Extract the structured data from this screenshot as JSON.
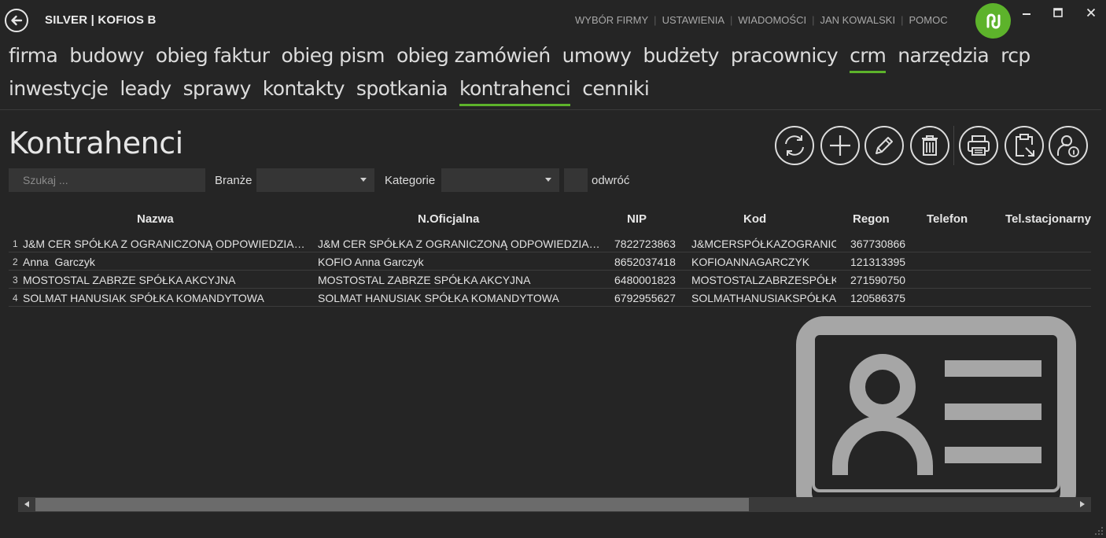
{
  "app": {
    "title": "SILVER | KOFIOS B"
  },
  "topnav": [
    {
      "label": "WYBÓR FIRMY"
    },
    {
      "label": "USTAWIENIA"
    },
    {
      "label": "WIADOMOŚCI"
    },
    {
      "label": "JAN KOWALSKI"
    },
    {
      "label": "POMOC"
    }
  ],
  "nav": {
    "row1": [
      {
        "label": "firma",
        "active": false
      },
      {
        "label": "budowy",
        "active": false
      },
      {
        "label": "obieg faktur",
        "active": false
      },
      {
        "label": "obieg pism",
        "active": false
      },
      {
        "label": "obieg zamówień",
        "active": false
      },
      {
        "label": "umowy",
        "active": false
      },
      {
        "label": "budżety",
        "active": false
      },
      {
        "label": "pracownicy",
        "active": false
      },
      {
        "label": "crm",
        "active": true
      },
      {
        "label": "narzędzia",
        "active": false
      },
      {
        "label": "rcp",
        "active": false
      }
    ],
    "row2": [
      {
        "label": "inwestycje",
        "active": false
      },
      {
        "label": "leady",
        "active": false
      },
      {
        "label": "sprawy",
        "active": false
      },
      {
        "label": "kontakty",
        "active": false
      },
      {
        "label": "spotkania",
        "active": false
      },
      {
        "label": "kontrahenci",
        "active": true
      },
      {
        "label": "cenniki",
        "active": false
      }
    ]
  },
  "page": {
    "title": "Kontrahenci"
  },
  "toolbar": [
    "refresh-icon",
    "plus-icon",
    "pencil-icon",
    "trash-icon",
    "printer-icon",
    "clipboard-export-icon",
    "user-info-icon"
  ],
  "filters": {
    "search_placeholder": "Szukaj ...",
    "branze_label": "Branże",
    "branze_value": "",
    "kategorie_label": "Kategorie",
    "kategorie_value": "",
    "reverse_label": "odwróć",
    "reverse_checked": false
  },
  "table": {
    "columns": [
      "Nazwa",
      "N.Oficjalna",
      "NIP",
      "Kod",
      "Regon",
      "Telefon",
      "Tel.stacjonarny"
    ],
    "rows": [
      {
        "num": "1",
        "nazwa": "J&M CER SPÓŁKA Z OGRANICZONĄ ODPOWIEDZIALNOŚCIĄ",
        "oficjalna": "J&M CER SPÓŁKA Z OGRANICZONĄ ODPOWIEDZIALNOŚCIĄ",
        "nip": "7822723863",
        "kod": "J&MCERSPÓŁKAZOGRANIC",
        "regon": "367730866",
        "telefon": "",
        "tel_stacjonarny": ""
      },
      {
        "num": "2",
        "nazwa": "Anna  Garczyk",
        "oficjalna": "KOFIO Anna Garczyk",
        "nip": "8652037418",
        "kod": "KOFIOANNAGARCZYK",
        "regon": "121313395",
        "telefon": "",
        "tel_stacjonarny": ""
      },
      {
        "num": "3",
        "nazwa": "MOSTOSTAL ZABRZE SPÓŁKA AKCYJNA",
        "oficjalna": "MOSTOSTAL ZABRZE SPÓŁKA AKCYJNA",
        "nip": "6480001823",
        "kod": "MOSTOSTALZABRZESPÓŁK",
        "regon": "271590750",
        "telefon": "",
        "tel_stacjonarny": ""
      },
      {
        "num": "4",
        "nazwa": "SOLMAT HANUSIAK SPÓŁKA KOMANDYTOWA",
        "oficjalna": "SOLMAT HANUSIAK SPÓŁKA KOMANDYTOWA",
        "nip": "6792955627",
        "kod": "SOLMATHANUSIAKSPÓŁKA",
        "regon": "120586375",
        "telefon": "",
        "tel_stacjonarny": ""
      }
    ]
  },
  "decor_icon": "contact-card-icon",
  "colors": {
    "accent": "#5db32b",
    "background": "#252525",
    "input_bg": "#353535"
  }
}
